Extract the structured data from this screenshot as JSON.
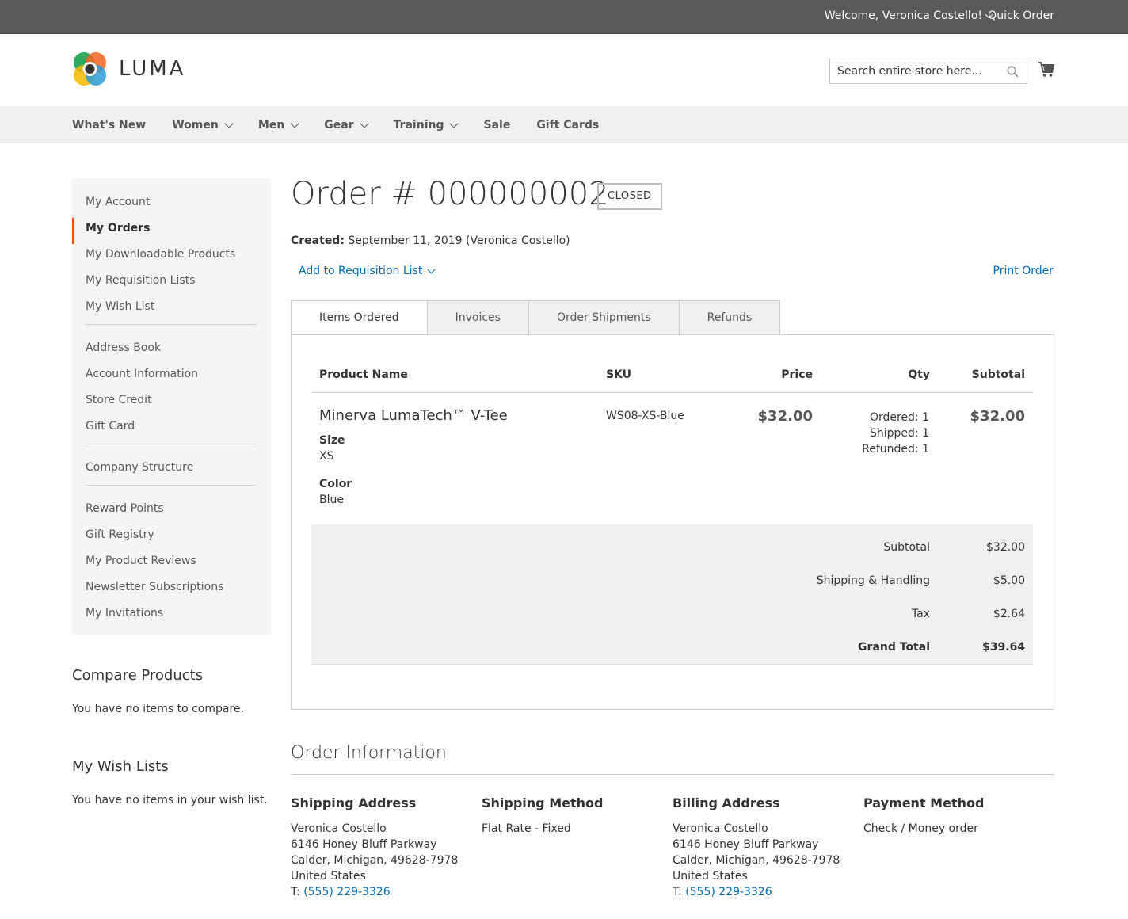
{
  "topbar": {
    "welcome": "Welcome, Veronica Costello!",
    "quick_order": "Quick Order"
  },
  "header": {
    "logo_text": "LUMA",
    "search_placeholder": "Search entire store here..."
  },
  "nav": {
    "items": [
      {
        "label": "What's New",
        "has_dropdown": false
      },
      {
        "label": "Women",
        "has_dropdown": true
      },
      {
        "label": "Men",
        "has_dropdown": true
      },
      {
        "label": "Gear",
        "has_dropdown": true
      },
      {
        "label": "Training",
        "has_dropdown": true
      },
      {
        "label": "Sale",
        "has_dropdown": false
      },
      {
        "label": "Gift Cards",
        "has_dropdown": false
      }
    ]
  },
  "sidebar": {
    "group1": [
      "My Account",
      "My Orders",
      "My Downloadable Products",
      "My Requisition Lists",
      "My Wish List"
    ],
    "group2": [
      "Address Book",
      "Account Information",
      "Store Credit",
      "Gift Card"
    ],
    "group3": [
      "Company Structure"
    ],
    "group4": [
      "Reward Points",
      "Gift Registry",
      "My Product Reviews",
      "Newsletter Subscriptions",
      "My Invitations"
    ],
    "active": "My Orders"
  },
  "compare": {
    "title": "Compare Products",
    "text": "You have no items to compare."
  },
  "wishlists": {
    "title": "My Wish Lists",
    "text": "You have no items in your wish list."
  },
  "order": {
    "title": "Order # 000000002",
    "status": "CLOSED",
    "created_label": "Created:",
    "created_value": "September 11, 2019 (Veronica Costello)",
    "add_to_requisition": "Add to Requisition List",
    "print": "Print Order"
  },
  "tabs": [
    "Items Ordered",
    "Invoices",
    "Order Shipments",
    "Refunds"
  ],
  "table": {
    "headers": {
      "name": "Product Name",
      "sku": "SKU",
      "price": "Price",
      "qty": "Qty",
      "subtotal": "Subtotal"
    },
    "item": {
      "name": "Minerva LumaTech™ V-Tee",
      "size_label": "Size",
      "size_value": "XS",
      "color_label": "Color",
      "color_value": "Blue",
      "sku": "WS08-XS-Blue",
      "price": "$32.00",
      "qty_ordered": "Ordered: 1",
      "qty_shipped": "Shipped: 1",
      "qty_refunded": "Refunded: 1",
      "subtotal": "$32.00"
    }
  },
  "totals": {
    "subtotal_label": "Subtotal",
    "subtotal": "$32.00",
    "shipping_label": "Shipping & Handling",
    "shipping": "$5.00",
    "tax_label": "Tax",
    "tax": "$2.64",
    "grand_label": "Grand Total",
    "grand": "$39.64"
  },
  "info": {
    "title": "Order Information",
    "shipping_address": {
      "title": "Shipping Address",
      "name": "Veronica Costello",
      "street": "6146 Honey Bluff Parkway",
      "city": "Calder, Michigan, 49628-7978",
      "country": "United States",
      "tel_prefix": "T:",
      "tel": "(555) 229-3326"
    },
    "shipping_method": {
      "title": "Shipping Method",
      "value": "Flat Rate - Fixed"
    },
    "billing_address": {
      "title": "Billing Address",
      "name": "Veronica Costello",
      "street": "6146 Honey Bluff Parkway",
      "city": "Calder, Michigan, 49628-7978",
      "country": "United States",
      "tel_prefix": "T:",
      "tel": "(555) 229-3326"
    },
    "payment_method": {
      "title": "Payment Method",
      "value": "Check / Money order"
    }
  },
  "colors": {
    "topbar": "#575a58",
    "link": "#006bb4",
    "active_marker": "#ff5501"
  }
}
